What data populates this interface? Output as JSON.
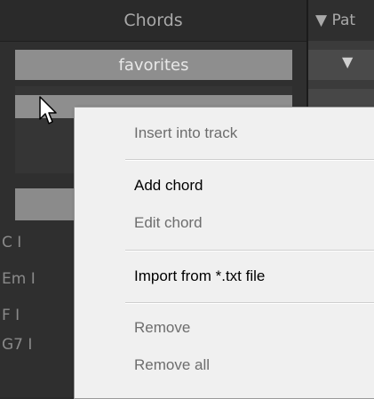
{
  "chords_panel": {
    "title": "Chords",
    "favorites_tab": "favorites",
    "chord_items": [
      "C I",
      "Em I",
      "F I",
      "G7 I"
    ]
  },
  "pattern_panel": {
    "title": "▼ Pat",
    "tab_arrow": "▼"
  },
  "context_menu": {
    "items": [
      {
        "label": "Insert into track",
        "enabled": false
      },
      {
        "label": "Add chord",
        "enabled": true
      },
      {
        "label": "Edit chord",
        "enabled": false
      },
      {
        "label": "Import from *.txt file",
        "enabled": true
      },
      {
        "label": "Remove",
        "enabled": false
      },
      {
        "label": "Remove all",
        "enabled": false
      }
    ]
  },
  "icons": {
    "cursor": "mouse-pointer-icon",
    "pattern_arrow": "triangle-down-icon"
  }
}
